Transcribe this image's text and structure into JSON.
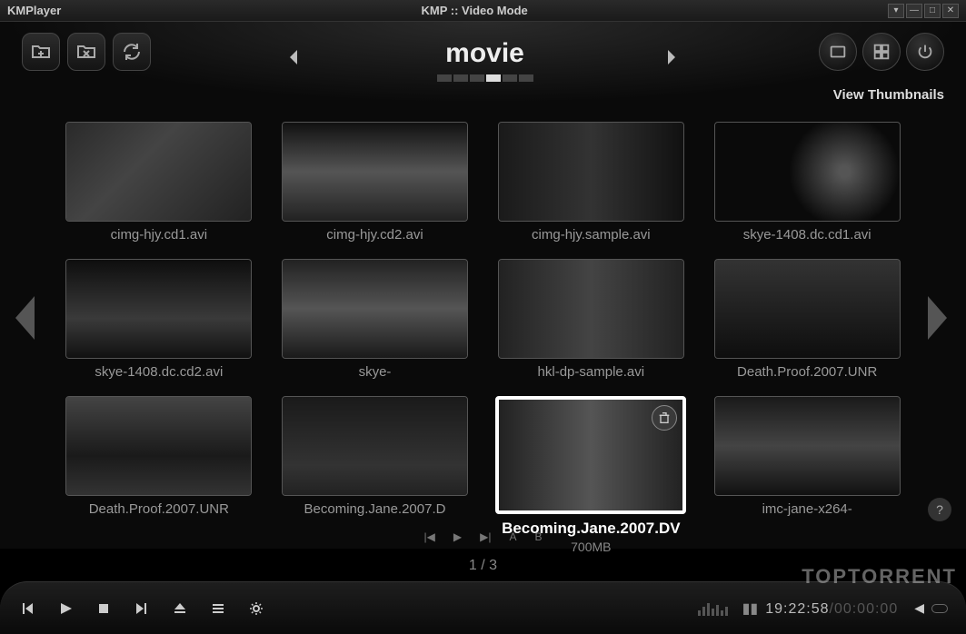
{
  "titlebar": {
    "app": "KMPlayer",
    "mode": "KMP :: Video Mode"
  },
  "top": {
    "title": "movie",
    "view_label": "View Thumbnails"
  },
  "pager": {
    "text": "1 / 3"
  },
  "items": [
    {
      "label": "cimg-hjy.cd1.avi"
    },
    {
      "label": "cimg-hjy.cd2.avi"
    },
    {
      "label": "cimg-hjy.sample.avi"
    },
    {
      "label": "skye-1408.dc.cd1.avi"
    },
    {
      "label": "skye-1408.dc.cd2.avi"
    },
    {
      "label": "skye-"
    },
    {
      "label": "hkl-dp-sample.avi"
    },
    {
      "label": "Death.Proof.2007.UNR"
    },
    {
      "label": "Death.Proof.2007.UNR"
    },
    {
      "label": "Becoming.Jane.2007.D"
    },
    {
      "label": "Becoming.Jane.2007.DV",
      "sublabel": "700MB",
      "selected": true
    },
    {
      "label": "imc-jane-x264-"
    }
  ],
  "help": "?",
  "time": {
    "current": "19:22:58",
    "total": "00:00:00"
  },
  "watermark": "TOPTORRENT",
  "ab": {
    "a": "A",
    "b": "B"
  }
}
